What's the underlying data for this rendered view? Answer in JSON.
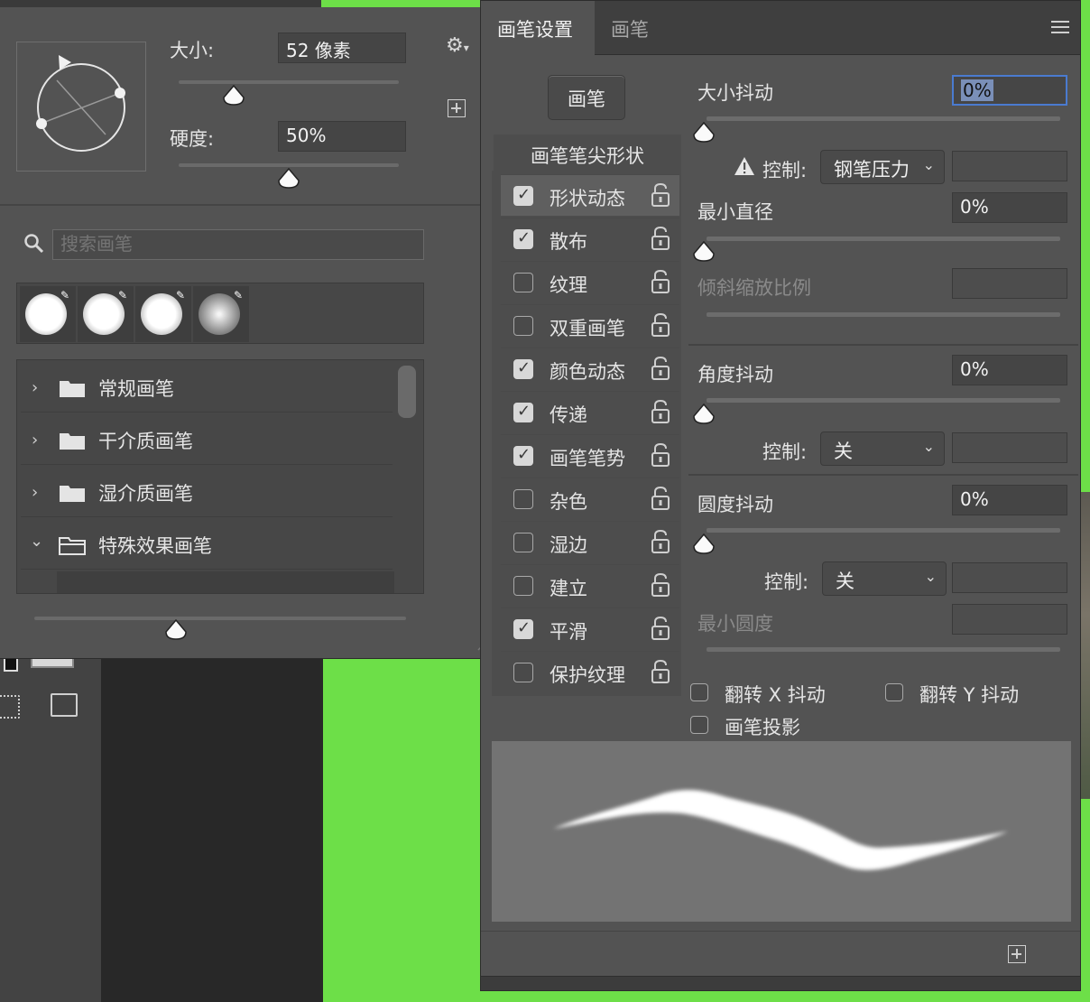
{
  "picker": {
    "size_label": "大小:",
    "size_value": "52 像素",
    "size_fraction": 0.25,
    "hardness_label": "硬度:",
    "hardness_value": "50%",
    "hardness_fraction": 0.5,
    "search_placeholder": "搜索画笔",
    "preview_size_fraction": 0.38,
    "groups": [
      {
        "name": "常规画笔",
        "expanded": false
      },
      {
        "name": "干介质画笔",
        "expanded": false
      },
      {
        "name": "湿介质画笔",
        "expanded": false
      },
      {
        "name": "特殊效果画笔",
        "expanded": true
      }
    ]
  },
  "settings": {
    "tabs": [
      "画笔设置",
      "画笔"
    ],
    "brush_button": "画笔",
    "tip_shape_label": "画笔笔尖形状",
    "options": [
      {
        "name": "形状动态",
        "checked": true,
        "selected": true
      },
      {
        "name": "散布",
        "checked": true,
        "selected": false
      },
      {
        "name": "纹理",
        "checked": false,
        "selected": false
      },
      {
        "name": "双重画笔",
        "checked": false,
        "selected": false
      },
      {
        "name": "颜色动态",
        "checked": true,
        "selected": false
      },
      {
        "name": "传递",
        "checked": true,
        "selected": false
      },
      {
        "name": "画笔笔势",
        "checked": true,
        "selected": false
      },
      {
        "name": "杂色",
        "checked": false,
        "selected": false
      },
      {
        "name": "湿边",
        "checked": false,
        "selected": false
      },
      {
        "name": "建立",
        "checked": false,
        "selected": false
      },
      {
        "name": "平滑",
        "checked": true,
        "selected": false
      },
      {
        "name": "保护纹理",
        "checked": false,
        "selected": false
      }
    ],
    "size_jitter": {
      "label": "大小抖动",
      "value": "0%"
    },
    "control_label": "控制:",
    "size_control": "钢笔压力",
    "min_diameter": {
      "label": "最小直径",
      "value": "0%"
    },
    "tilt_scale": {
      "label": "倾斜缩放比例"
    },
    "angle_jitter": {
      "label": "角度抖动",
      "value": "0%"
    },
    "angle_control": "关",
    "roundness_jitter": {
      "label": "圆度抖动",
      "value": "0%"
    },
    "roundness_control": "关",
    "min_roundness": {
      "label": "最小圆度"
    },
    "flip_x": {
      "label": "翻转 X 抖动",
      "checked": false
    },
    "flip_y": {
      "label": "翻转 Y 抖动",
      "checked": false
    },
    "brush_projection": {
      "label": "画笔投影",
      "checked": false
    }
  }
}
